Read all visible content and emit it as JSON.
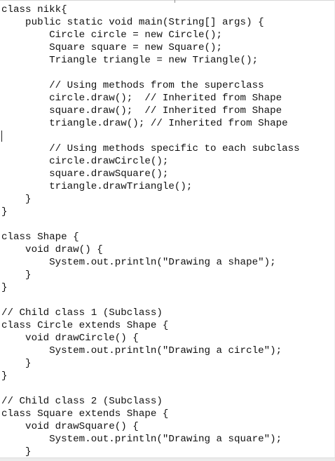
{
  "code": {
    "lines": [
      "class nikk{",
      "    public static void main(String[] args) {",
      "        Circle circle = new Circle();",
      "        Square square = new Square();",
      "        Triangle triangle = new Triangle();",
      "",
      "        // Using methods from the superclass",
      "        circle.draw();  // Inherited from Shape",
      "        square.draw();  // Inherited from Shape",
      "        triangle.draw(); // Inherited from Shape",
      "",
      "        // Using methods specific to each subclass",
      "        circle.drawCircle();",
      "        square.drawSquare();",
      "        triangle.drawTriangle();",
      "    }",
      "}",
      "",
      "class Shape {",
      "    void draw() {",
      "        System.out.println(\"Drawing a shape\");",
      "    }",
      "}",
      "",
      "// Child class 1 (Subclass)",
      "class Circle extends Shape {",
      "    void drawCircle() {",
      "        System.out.println(\"Drawing a circle\");",
      "    }",
      "}",
      "",
      "// Child class 2 (Subclass)",
      "class Square extends Shape {",
      "    void drawSquare() {",
      "        System.out.println(\"Drawing a square\");",
      "    }"
    ]
  }
}
